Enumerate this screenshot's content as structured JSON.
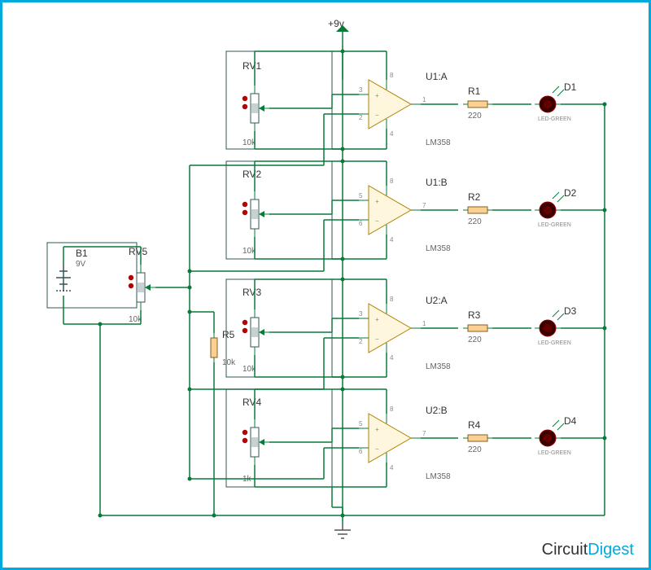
{
  "supply": {
    "label": "+9v"
  },
  "battery": {
    "ref": "B1",
    "value": "9V"
  },
  "input_pot": {
    "ref": "RV5",
    "value": "10k"
  },
  "input_res": {
    "ref": "R5",
    "value": "10k"
  },
  "stages": [
    {
      "pot_ref": "RV1",
      "pot_val": "10k",
      "amp_ref": "U1:A",
      "amp_part": "LM358",
      "pin_plus": "3",
      "pin_minus": "2",
      "pin_out": "1",
      "pin_vcc": "8",
      "pin_vee": "4",
      "r_ref": "R1",
      "r_val": "220",
      "led_ref": "D1",
      "led_val": "LED-GREEN"
    },
    {
      "pot_ref": "RV2",
      "pot_val": "10k",
      "amp_ref": "U1:B",
      "amp_part": "LM358",
      "pin_plus": "5",
      "pin_minus": "6",
      "pin_out": "7",
      "pin_vcc": "8",
      "pin_vee": "4",
      "r_ref": "R2",
      "r_val": "220",
      "led_ref": "D2",
      "led_val": "LED-GREEN"
    },
    {
      "pot_ref": "RV3",
      "pot_val": "10k",
      "amp_ref": "U2:A",
      "amp_part": "LM358",
      "pin_plus": "3",
      "pin_minus": "2",
      "pin_out": "1",
      "pin_vcc": "8",
      "pin_vee": "4",
      "r_ref": "R3",
      "r_val": "220",
      "led_ref": "D3",
      "led_val": "LED-GREEN"
    },
    {
      "pot_ref": "RV4",
      "pot_val": "1k",
      "amp_ref": "U2:B",
      "amp_part": "LM358",
      "pin_plus": "5",
      "pin_minus": "6",
      "pin_out": "7",
      "pin_vcc": "8",
      "pin_vee": "4",
      "r_ref": "R4",
      "r_val": "220",
      "led_ref": "D4",
      "led_val": "LED-GREEN"
    }
  ],
  "brand": {
    "a": "Circuit",
    "b": "Digest"
  }
}
